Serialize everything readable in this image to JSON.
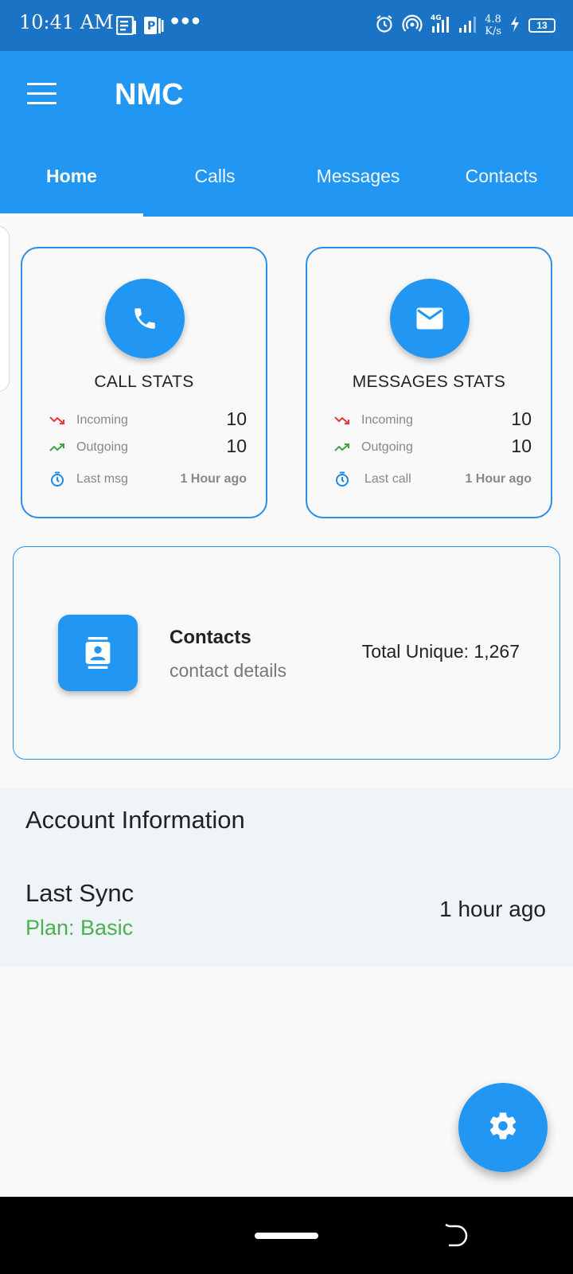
{
  "status_bar": {
    "time": "10:41 AM",
    "network_speed_value": "4.8",
    "network_speed_unit": "K/s",
    "network_type": "4G",
    "battery": "13",
    "icons": [
      "news-icon",
      "parking-icon",
      "more-dots-icon",
      "alarm-icon",
      "hotspot-icon",
      "signal-4g-icon",
      "signal-icon",
      "charging-icon",
      "battery-icon"
    ]
  },
  "app_bar": {
    "title": "NMC",
    "menu_icon": "menu-icon",
    "color": "#2196f3"
  },
  "tabs": [
    {
      "label": "Home",
      "active": true
    },
    {
      "label": "Calls",
      "active": false
    },
    {
      "label": "Messages",
      "active": false
    },
    {
      "label": "Contacts",
      "active": false
    }
  ],
  "call_stats": {
    "title": "CALL STATS",
    "icon": "phone-icon",
    "incoming_label": "Incoming",
    "incoming_value": "10",
    "outgoing_label": "Outgoing",
    "outgoing_value": "10",
    "last_label": "Last msg",
    "last_value": "1 Hour ago"
  },
  "messages_stats": {
    "title": "MESSAGES STATS",
    "icon": "mail-icon",
    "incoming_label": "Incoming",
    "incoming_value": "10",
    "outgoing_label": "Outgoing",
    "outgoing_value": "10",
    "last_label": "Last call",
    "last_value": "1 Hour ago"
  },
  "contacts_card": {
    "icon": "contact-card-icon",
    "title": "Contacts",
    "subtitle": "contact details",
    "total": "Total Unique: 1,267"
  },
  "account": {
    "heading": "Account Information",
    "sync_label": "Last Sync",
    "plan": "Plan: Basic",
    "sync_value": "1 hour ago",
    "plan_color": "#4caf50"
  },
  "fab": {
    "icon": "gear-icon"
  },
  "colors": {
    "incoming": "#e53935",
    "outgoing": "#43a047",
    "timer": "#1e88e5",
    "accent": "#2196f3"
  }
}
